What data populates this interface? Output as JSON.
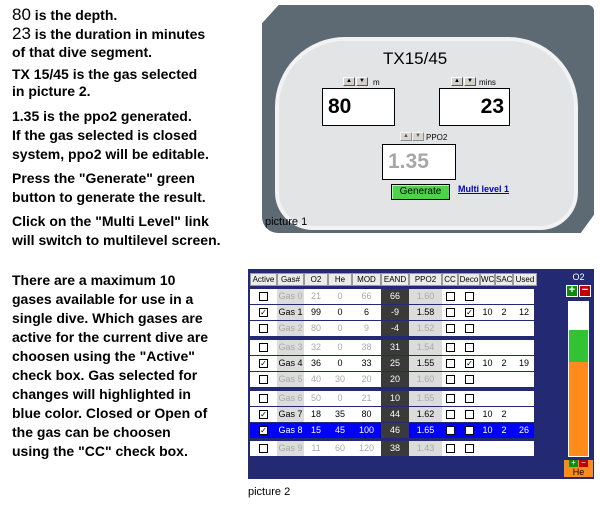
{
  "instructions": {
    "l1_num": "80",
    "l1_rest": " is the depth.",
    "l2_num": "23",
    "l2_rest": " is the duration in minutes",
    "l3": "of that dive segment.",
    "l4": "TX 15/45 is the gas selected",
    "l5": "in picture 2.",
    "l6": "1.35 is the ppo2 generated.",
    "l7": "If the gas selected is closed",
    "l8": "system, ppo2 will be editable.",
    "l9": "Press the \"Generate\" green",
    "l10": "button to generate the result.",
    "l11": "Click on the \"Multi Level\" link",
    "l12": "will switch to multilevel screen."
  },
  "gas_paragraph": [
    "There are a maximum 10",
    "gases available for use in a",
    "single dive. Which gases are",
    "active for the current dive are",
    "choosen using the \"Active\"",
    "check box. Gas selected for",
    "changes will highlighted in",
    "blue color. Closed or Open of",
    "the gas can be choosen",
    "using the \"CC\" check box."
  ],
  "picture1": {
    "title": "TX15/45",
    "depth_label": "m",
    "depth_value": "80",
    "mins_label": "mins",
    "mins_value": "23",
    "ppo2_label": "PPO2",
    "ppo2_value": "1.35",
    "generate_label": "Generate",
    "multi_level_label": "Multi level 1",
    "caption": "picture 1",
    "colors": {
      "frame": "#5d6a73",
      "panel": "#e3e4e5",
      "generate": "#4fd24b",
      "link": "#0000c8"
    }
  },
  "picture2": {
    "caption": "picture 2",
    "headers": [
      "Active",
      "Gas#",
      "O2",
      "He",
      "MOD m",
      "EAND",
      "PPO2",
      "CC",
      "Deco",
      "WC",
      "SAC",
      "Used"
    ],
    "rows": [
      {
        "active": false,
        "gas": "Gas 0",
        "o2": "21",
        "he": "0",
        "mod": "66",
        "eand": "66",
        "ppo2": "1.60",
        "cc": false,
        "deco": false,
        "wc": "",
        "sac": "",
        "used": "",
        "enabled": false,
        "selected": false
      },
      {
        "active": true,
        "gas": "Gas 1",
        "o2": "99",
        "he": "0",
        "mod": "6",
        "eand": "-9",
        "ppo2": "1.58",
        "cc": false,
        "deco": true,
        "wc": "10",
        "sac": "2",
        "used": "12",
        "enabled": true,
        "selected": false
      },
      {
        "active": false,
        "gas": "Gas 2",
        "o2": "80",
        "he": "0",
        "mod": "9",
        "eand": "-4",
        "ppo2": "1.52",
        "cc": false,
        "deco": false,
        "wc": "",
        "sac": "",
        "used": "",
        "enabled": false,
        "selected": false
      },
      {
        "active": false,
        "gas": "Gas 3",
        "o2": "32",
        "he": "0",
        "mod": "38",
        "eand": "31",
        "ppo2": "1.54",
        "cc": false,
        "deco": false,
        "wc": "",
        "sac": "",
        "used": "",
        "enabled": false,
        "selected": false
      },
      {
        "active": true,
        "gas": "Gas 4",
        "o2": "36",
        "he": "0",
        "mod": "33",
        "eand": "25",
        "ppo2": "1.55",
        "cc": false,
        "deco": true,
        "wc": "10",
        "sac": "2",
        "used": "19",
        "enabled": true,
        "selected": false
      },
      {
        "active": false,
        "gas": "Gas 5",
        "o2": "40",
        "he": "30",
        "mod": "20",
        "eand": "20",
        "ppo2": "1.60",
        "cc": false,
        "deco": false,
        "wc": "",
        "sac": "",
        "used": "",
        "enabled": false,
        "selected": false
      },
      {
        "active": false,
        "gas": "Gas 6",
        "o2": "50",
        "he": "0",
        "mod": "21",
        "eand": "10",
        "ppo2": "1.55",
        "cc": false,
        "deco": false,
        "wc": "",
        "sac": "",
        "used": "",
        "enabled": false,
        "selected": false
      },
      {
        "active": true,
        "gas": "Gas 7",
        "o2": "18",
        "he": "35",
        "mod": "80",
        "eand": "44",
        "ppo2": "1.62",
        "cc": false,
        "deco": false,
        "wc": "10",
        "sac": "2",
        "used": "",
        "enabled": true,
        "selected": false
      },
      {
        "active": true,
        "gas": "Gas 8",
        "o2": "15",
        "he": "45",
        "mod": "100",
        "eand": "46",
        "ppo2": "1.65",
        "cc": false,
        "deco": false,
        "wc": "10",
        "sac": "2",
        "used": "26",
        "enabled": true,
        "selected": true
      },
      {
        "active": false,
        "gas": "Gas 9",
        "o2": "11",
        "he": "60",
        "mod": "120",
        "eand": "38",
        "ppo2": "1.43",
        "cc": false,
        "deco": false,
        "wc": "",
        "sac": "",
        "used": "",
        "enabled": false,
        "selected": false
      }
    ],
    "o2_gauge": {
      "label": "O2",
      "bottom_label": "He",
      "o2_fraction": 0.15,
      "he_fraction": 0.45,
      "colors": {
        "o2": "#33c233",
        "he": "#ff8c1a",
        "nitrogen": "#ffffff"
      }
    },
    "colors": {
      "background": "#232a73",
      "selected": "#0000ff",
      "eand_column": "#3a3a3a"
    }
  }
}
